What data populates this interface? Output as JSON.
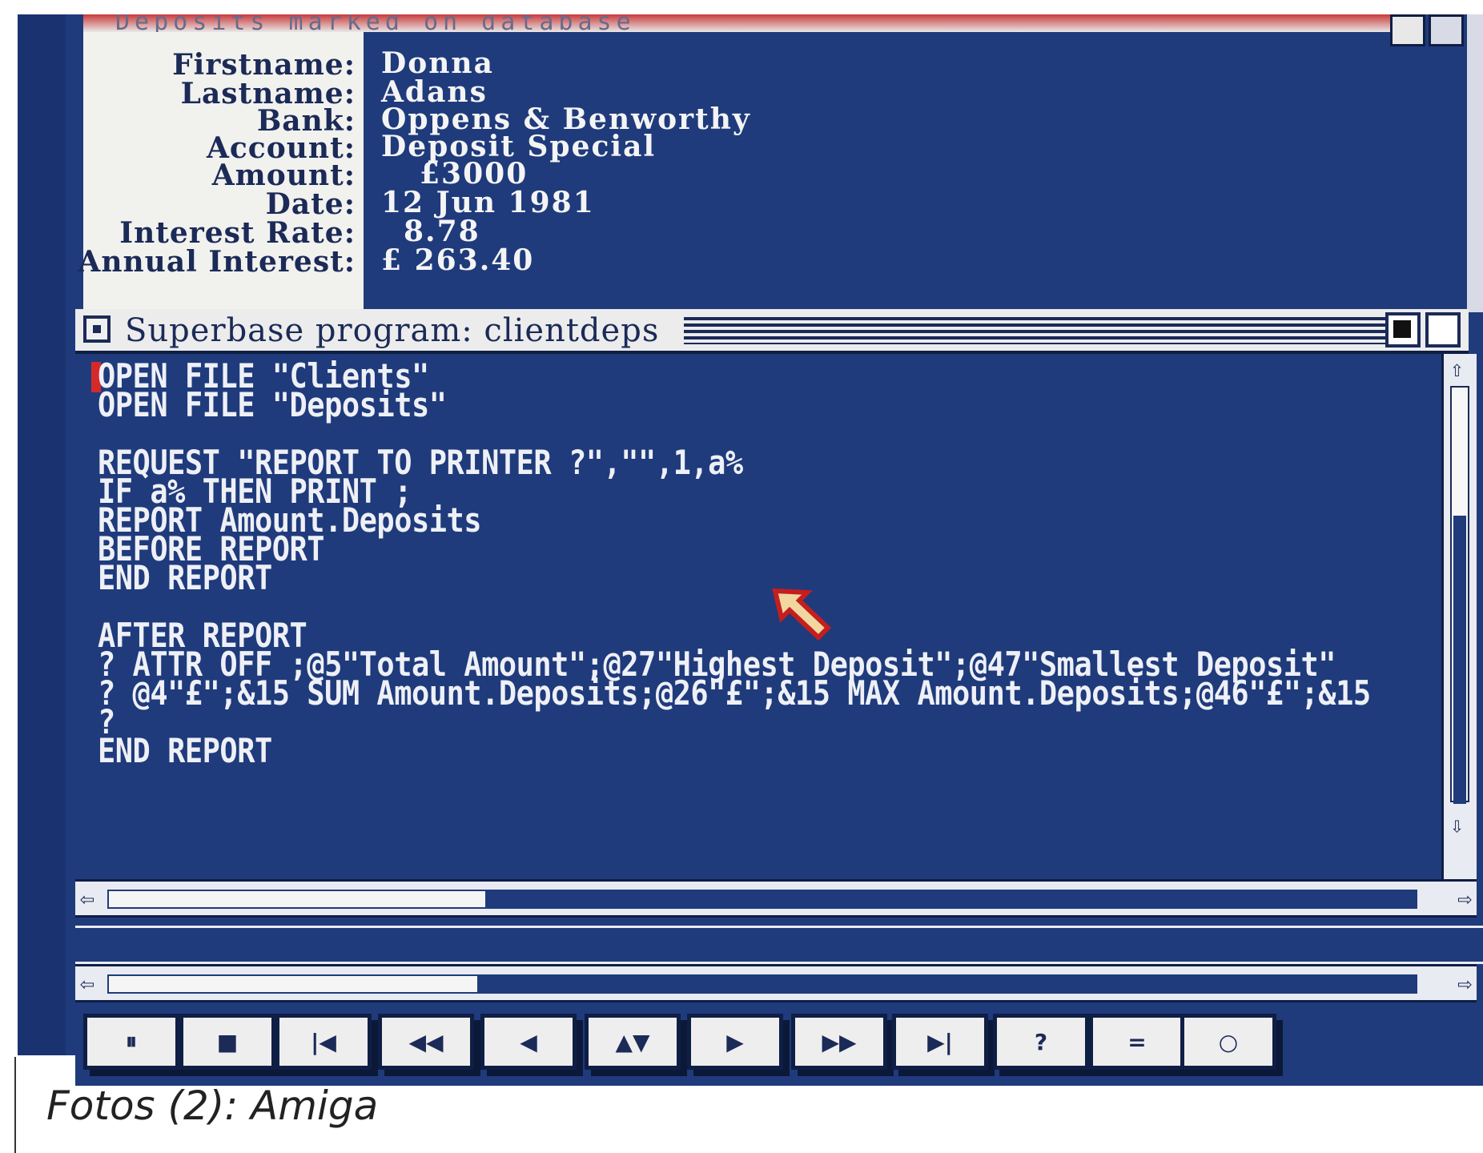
{
  "record_window": {
    "title": "Deposits marked on database",
    "fields": [
      {
        "label": "Firstname:",
        "value": "Donna"
      },
      {
        "label": "Lastname:",
        "value": "Adans"
      },
      {
        "label": "Bank:",
        "value": "Oppens & Benworthy"
      },
      {
        "label": "Account:",
        "value": "Deposit Special"
      },
      {
        "label": "Amount:",
        "value": "£3000"
      },
      {
        "label": "Date:",
        "value": "12 Jun 1981"
      },
      {
        "label": "Interest Rate:",
        "value": "8.78"
      },
      {
        "label": "Annual Interest:",
        "value": "£    263.40"
      }
    ]
  },
  "program_window": {
    "title": "Superbase program: clientdeps",
    "code_lines": [
      "OPEN FILE \"Clients\"",
      "OPEN FILE \"Deposits\"",
      "",
      "REQUEST \"REPORT TO PRINTER ?\",\"\",1,a%",
      "IF a% THEN PRINT ;",
      "REPORT Amount.Deposits",
      "BEFORE REPORT",
      "END REPORT",
      "",
      "AFTER REPORT",
      "? ATTR OFF ;@5\"Total Amount\";@27\"Highest Deposit\";@47\"Smallest Deposit\"",
      "? @4\"£\";&15 SUM Amount.Deposits;@26\"£\";&15 MAX Amount.Deposits;@46\"£\";&15",
      "?",
      "END REPORT"
    ]
  },
  "control_bar": {
    "buttons": [
      {
        "icon": "pause-icon",
        "glyph": "⏸"
      },
      {
        "icon": "stop-icon",
        "glyph": "■"
      },
      {
        "icon": "first-record-icon",
        "glyph": "|◀"
      },
      {
        "icon": "rewind-icon",
        "glyph": "◀◀"
      },
      {
        "icon": "previous-record-icon",
        "glyph": "◀"
      },
      {
        "icon": "up-down-icon",
        "glyph": "▲▼"
      },
      {
        "icon": "next-record-icon",
        "glyph": "▶"
      },
      {
        "icon": "fast-forward-icon",
        "glyph": "▶▶"
      },
      {
        "icon": "last-record-icon",
        "glyph": "▶|"
      },
      {
        "icon": "query-icon",
        "glyph": "?"
      },
      {
        "icon": "equals-icon",
        "glyph": "="
      },
      {
        "icon": "record-icon",
        "glyph": "○"
      }
    ]
  },
  "caption": "Fotos (2): Amiga",
  "colors": {
    "screen_blue": "#1f3b7c",
    "label_panel": "#f1f1ee",
    "cursor_red": "#d42a2a"
  }
}
